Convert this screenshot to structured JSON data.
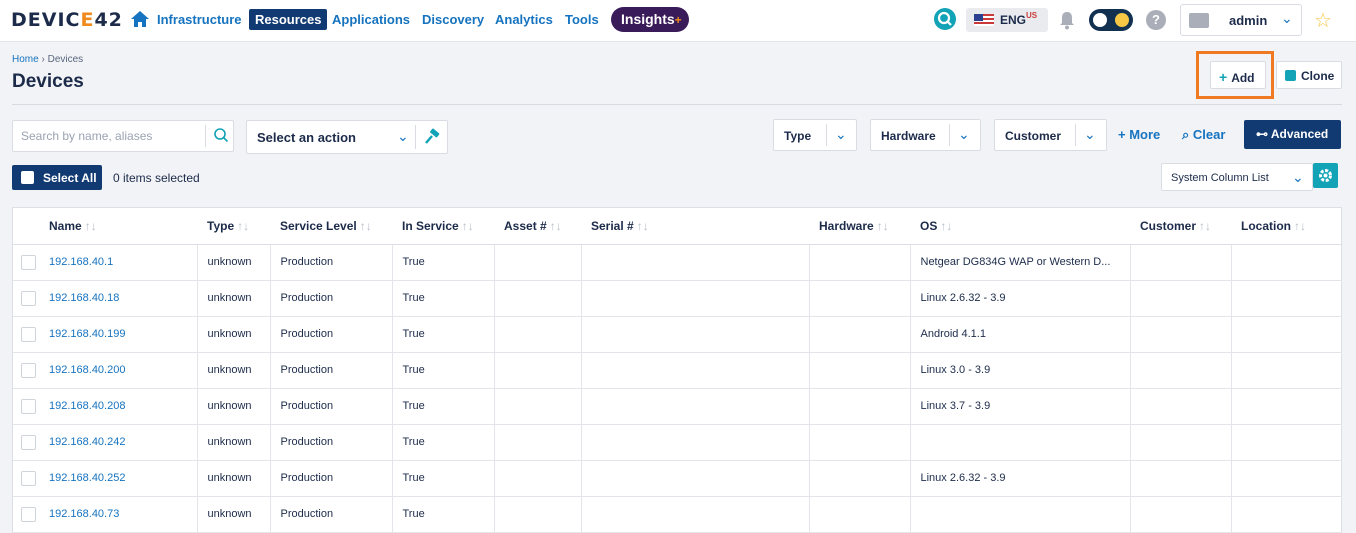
{
  "nav": {
    "logo_main": "DEVIC",
    "logo_accent": "E",
    "logo_tail": "42",
    "links": [
      "Infrastructure",
      "Resources",
      "Applications",
      "Discovery",
      "Analytics",
      "Tools"
    ],
    "active": "Resources",
    "insights_label": "Insights",
    "insights_plus": "+",
    "language_code": "ENG",
    "language_region": "US",
    "user": "admin"
  },
  "header": {
    "breadcrumb_home": "Home",
    "breadcrumb_separator": "›",
    "breadcrumb_current": "Devices",
    "title": "Devices",
    "add_label": "Add",
    "clone_label": "Clone"
  },
  "filters": {
    "search_placeholder": "Search by name, aliases",
    "action_label": "Select an action",
    "type_label": "Type",
    "hardware_label": "Hardware",
    "customer_label": "Customer",
    "more_label": "More",
    "clear_label": "Clear",
    "advanced_label": "Advanced"
  },
  "selection": {
    "select_all_label": "Select All",
    "items_selected": "0 items selected",
    "column_list_value": "System Column List"
  },
  "table": {
    "columns": [
      "Name",
      "Type",
      "Service Level",
      "In Service",
      "Asset #",
      "Serial #",
      "Hardware",
      "OS",
      "Customer",
      "Location"
    ],
    "rows": [
      {
        "name": "192.168.40.1",
        "type": "unknown",
        "service_level": "Production",
        "in_service": "True",
        "asset": "",
        "serial": "",
        "hardware": "",
        "os": "Netgear DG834G WAP or Western D...",
        "customer": "",
        "location": ""
      },
      {
        "name": "192.168.40.18",
        "type": "unknown",
        "service_level": "Production",
        "in_service": "True",
        "asset": "",
        "serial": "",
        "hardware": "",
        "os": "Linux 2.6.32 - 3.9",
        "customer": "",
        "location": ""
      },
      {
        "name": "192.168.40.199",
        "type": "unknown",
        "service_level": "Production",
        "in_service": "True",
        "asset": "",
        "serial": "",
        "hardware": "",
        "os": "Android 4.1.1",
        "customer": "",
        "location": ""
      },
      {
        "name": "192.168.40.200",
        "type": "unknown",
        "service_level": "Production",
        "in_service": "True",
        "asset": "",
        "serial": "",
        "hardware": "",
        "os": "Linux 3.0 - 3.9",
        "customer": "",
        "location": ""
      },
      {
        "name": "192.168.40.208",
        "type": "unknown",
        "service_level": "Production",
        "in_service": "True",
        "asset": "",
        "serial": "",
        "hardware": "",
        "os": "Linux 3.7 - 3.9",
        "customer": "",
        "location": ""
      },
      {
        "name": "192.168.40.242",
        "type": "unknown",
        "service_level": "Production",
        "in_service": "True",
        "asset": "",
        "serial": "",
        "hardware": "",
        "os": "",
        "customer": "",
        "location": ""
      },
      {
        "name": "192.168.40.252",
        "type": "unknown",
        "service_level": "Production",
        "in_service": "True",
        "asset": "",
        "serial": "",
        "hardware": "",
        "os": "Linux 2.6.32 - 3.9",
        "customer": "",
        "location": ""
      },
      {
        "name": "192.168.40.73",
        "type": "unknown",
        "service_level": "Production",
        "in_service": "True",
        "asset": "",
        "serial": "",
        "hardware": "",
        "os": "",
        "customer": "",
        "location": ""
      }
    ]
  },
  "colors": {
    "navy": "#123a72",
    "link": "#1673bf",
    "teal": "#12a3b6",
    "orange": "#f07a22",
    "insights_bg": "#3a1b5a"
  },
  "icons": [
    "home-icon",
    "search-icon",
    "flag-us-icon",
    "bell-icon",
    "theme-toggle-icon",
    "help-icon",
    "briefcase-icon",
    "chevron-down-icon",
    "star-icon",
    "plus-icon",
    "clone-icon",
    "hammer-icon",
    "filter-clear-icon",
    "binoculars-icon",
    "gear-icon",
    "sort-icon"
  ]
}
